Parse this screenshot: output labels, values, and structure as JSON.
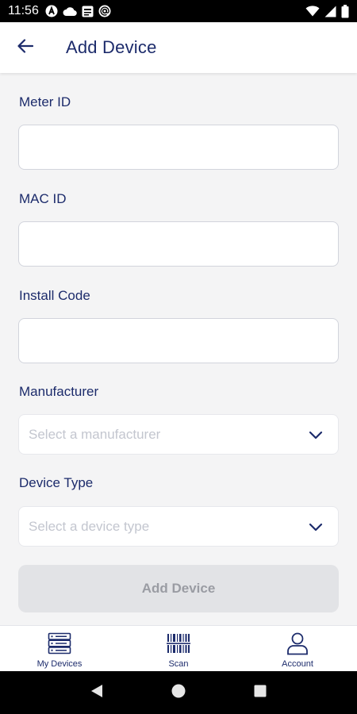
{
  "status_bar": {
    "time": "11:56",
    "left_icons": [
      "a-circle-icon",
      "cloud-icon",
      "news-icon",
      "at-sign-icon"
    ],
    "right_icons": [
      "wifi-icon",
      "signal-icon",
      "battery-icon"
    ]
  },
  "header": {
    "back_icon": "arrow-left-icon",
    "title": "Add Device"
  },
  "form": {
    "meter_id": {
      "label": "Meter ID",
      "value": "",
      "placeholder": ""
    },
    "mac_id": {
      "label": "MAC ID",
      "value": "",
      "placeholder": ""
    },
    "install_code": {
      "label": "Install Code",
      "value": "",
      "placeholder": ""
    },
    "manufacturer": {
      "label": "Manufacturer",
      "placeholder": "Select a manufacturer",
      "icon": "chevron-down-icon"
    },
    "device_type": {
      "label": "Device Type",
      "placeholder": "Select a device type",
      "icon": "chevron-down-icon"
    },
    "submit_label": "Add Device"
  },
  "bottom_nav": {
    "items": [
      {
        "label": "My Devices",
        "icon": "server-icon"
      },
      {
        "label": "Scan",
        "icon": "barcode-icon"
      },
      {
        "label": "Account",
        "icon": "person-icon"
      }
    ]
  },
  "system_nav": {
    "icons": [
      "back-triangle-icon",
      "home-circle-icon",
      "recents-square-icon"
    ]
  },
  "colors": {
    "primary_text": "#1c2b6b",
    "background": "#f4f4f5",
    "disabled_button": "#e2e3e6",
    "disabled_text": "#9a9ca3",
    "placeholder": "#c3c6cf"
  }
}
